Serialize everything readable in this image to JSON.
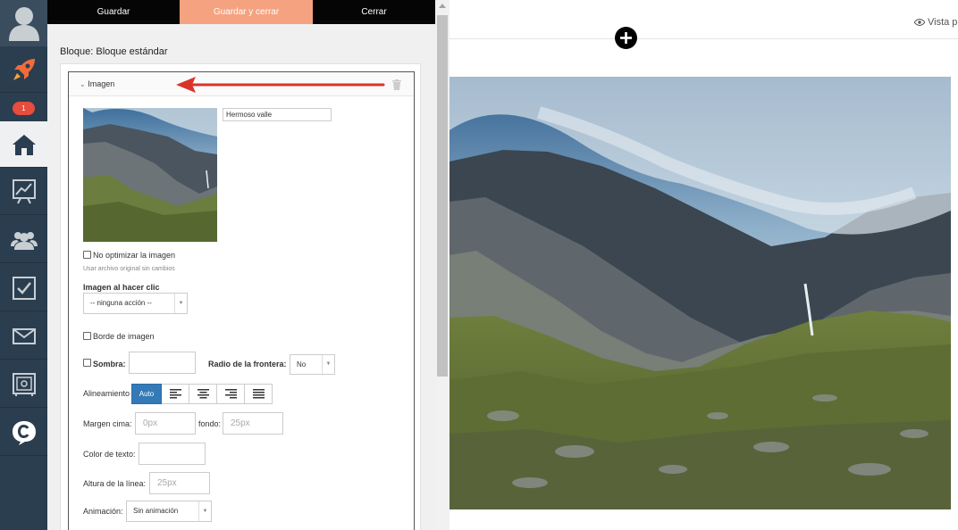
{
  "topbar": {
    "save_label": "Guardar",
    "save_close_label": "Guardar y cerrar",
    "close_label": "Cerrar"
  },
  "nav": {
    "badge_count": "1",
    "icons": [
      "avatar-icon",
      "rocket-icon",
      "home-icon",
      "chart-icon",
      "users-icon",
      "checkbox-icon",
      "mail-icon",
      "safe-icon",
      "chat-icon"
    ]
  },
  "panel": {
    "block_title": "Bloque: Bloque estándar",
    "section_title": "Imagen",
    "image_alt_value": "Hermoso valle",
    "no_optimize_label": "No optimizar la imagen",
    "no_optimize_hint": "Usar archivo original sin cambios",
    "click_image_label": "Imagen al hacer clic",
    "click_action_value": "-- ninguna acción --",
    "border_label": "Borde de imagen",
    "shadow_label": "Sombra:",
    "border_radius_label": "Radio de la frontera:",
    "border_radius_value": "No",
    "alignment_label": "Alineamiento",
    "alignment_auto": "Auto",
    "margin_top_label": "Margen cima:",
    "margin_top_placeholder": "0px",
    "margin_bottom_label": "fondo:",
    "margin_bottom_placeholder": "25px",
    "text_color_label": "Color de texto:",
    "line_height_label": "Altura de la línea:",
    "line_height_placeholder": "25px",
    "animation_label": "Animación:",
    "animation_value": "Sin animación"
  },
  "preview": {
    "preview_label": "Vista pr"
  },
  "colors": {
    "nav_bg": "#2b3e50",
    "save_close_bg": "#f4a27f",
    "accent_blue": "#337ab7",
    "arrow_red": "#d9342b"
  }
}
